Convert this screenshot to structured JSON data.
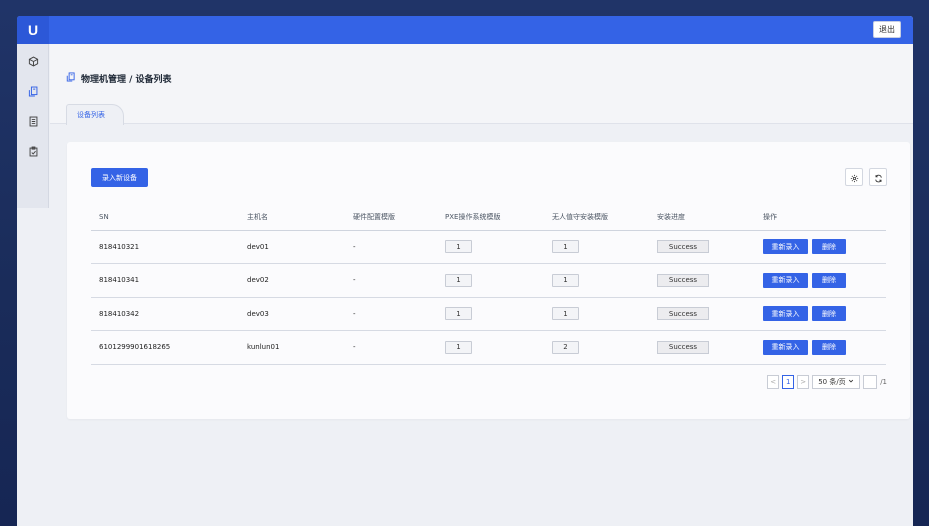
{
  "header": {
    "logo_text": "U",
    "logout_label": "退出"
  },
  "sidebar": {
    "items": [
      {
        "icon": "cube-icon",
        "active": false
      },
      {
        "icon": "server-icon",
        "active": true
      },
      {
        "icon": "document-icon",
        "active": false
      },
      {
        "icon": "clipboard-icon",
        "active": false
      }
    ]
  },
  "breadcrumb": {
    "text": "物理机管理 / 设备列表",
    "icon": "server-icon"
  },
  "tabs": [
    {
      "label": "设备列表",
      "active": true
    }
  ],
  "toolbar": {
    "add_label": "录入新设备",
    "settings_icon": "gear-icon",
    "refresh_icon": "refresh-icon"
  },
  "table": {
    "columns": [
      "SN",
      "主机名",
      "硬件配置模版",
      "PXE操作系统模版",
      "无人值守安装模版",
      "安装进度",
      "操作"
    ],
    "rows": [
      {
        "sn": "818410321",
        "host": "dev01",
        "hw": "-",
        "pxe": "1",
        "unattended": "1",
        "status": "Success",
        "re": "重新录入",
        "del": "删除"
      },
      {
        "sn": "818410341",
        "host": "dev02",
        "hw": "-",
        "pxe": "1",
        "unattended": "1",
        "status": "Success",
        "re": "重新录入",
        "del": "删除"
      },
      {
        "sn": "818410342",
        "host": "dev03",
        "hw": "-",
        "pxe": "1",
        "unattended": "1",
        "status": "Success",
        "re": "重新录入",
        "del": "删除"
      },
      {
        "sn": "6101299901618265",
        "host": "kunlun01",
        "hw": "-",
        "pxe": "1",
        "unattended": "2",
        "status": "Success",
        "re": "重新录入",
        "del": "删除"
      }
    ]
  },
  "pagination": {
    "prev": "<",
    "current": "1",
    "next": ">",
    "page_size": "50 条/页",
    "jump_value": "",
    "total": "/1"
  },
  "colors": {
    "accent": "#3463e6"
  }
}
